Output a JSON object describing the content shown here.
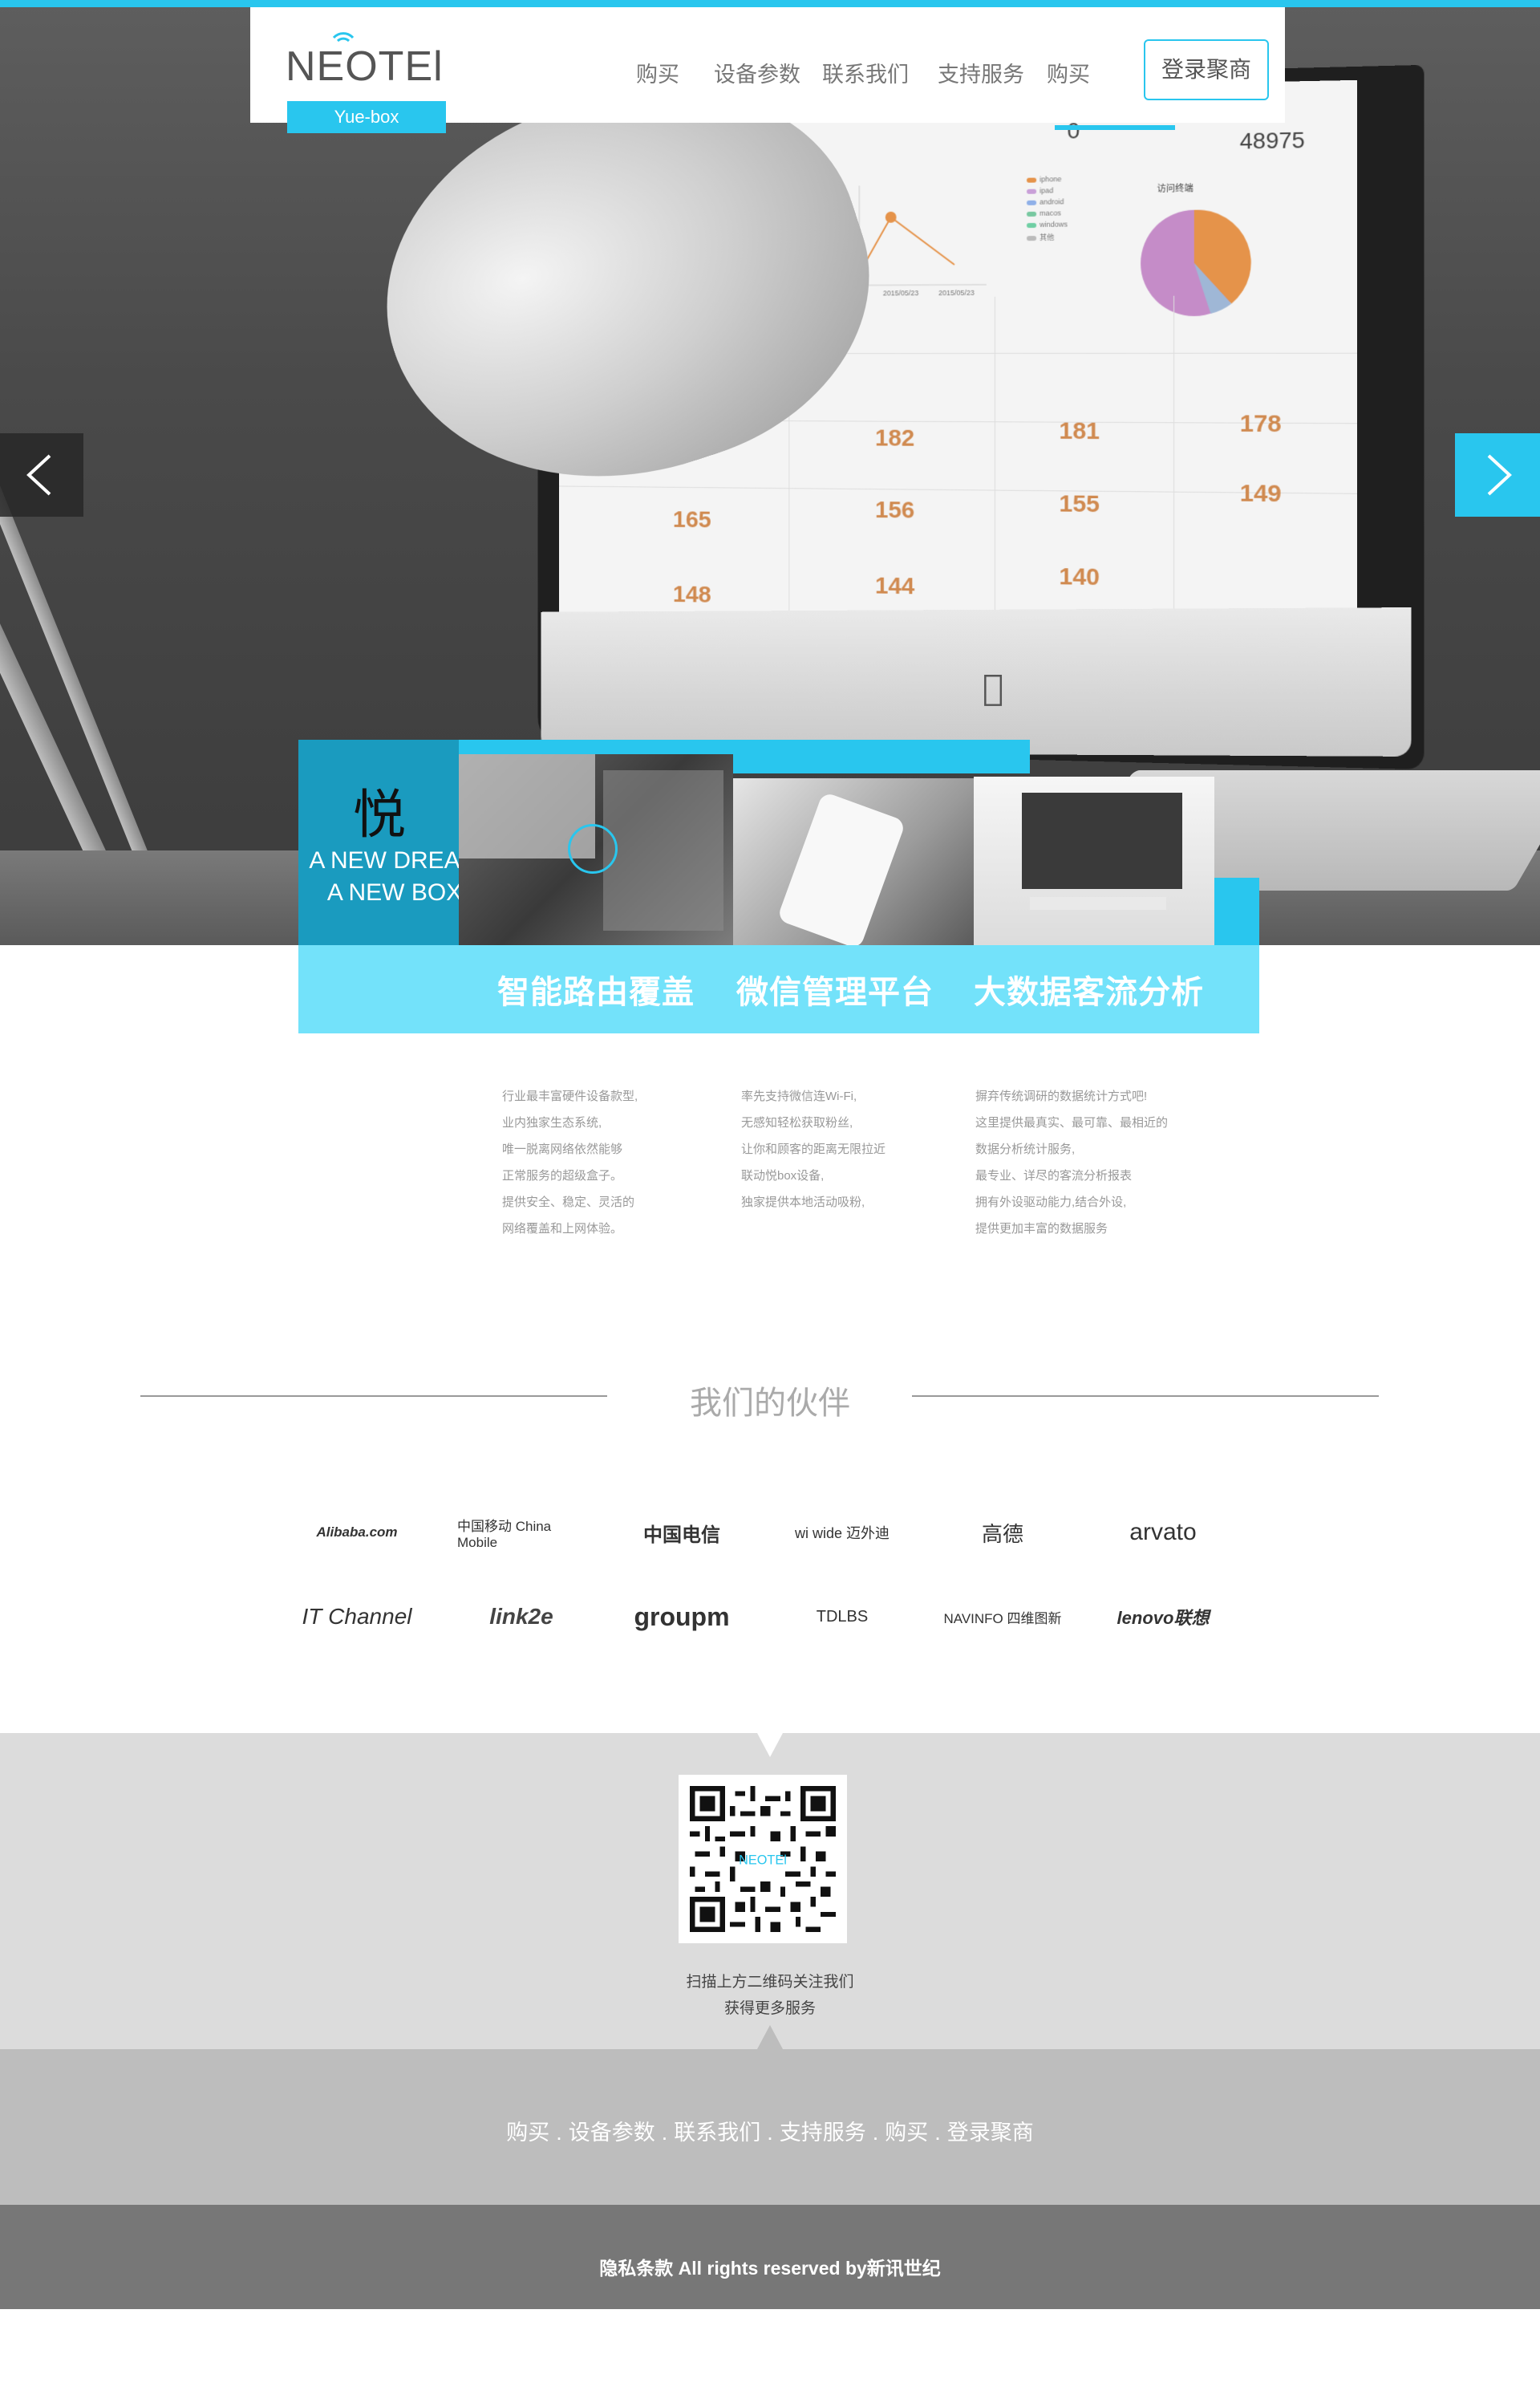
{
  "brand": {
    "logo": "NEOTEl",
    "sub": "Yue-box",
    "char": "悦",
    "slogan_line1": "A NEW DREAM",
    "slogan_line2": "A NEW BOX"
  },
  "nav": {
    "items": [
      "购买",
      "设备参数",
      "联系我们",
      "支持服务",
      "购买"
    ],
    "active_index": 2,
    "login_label": "登录聚商"
  },
  "hero_screen": {
    "top_value": "0",
    "visits_value": "48975",
    "visits_caption": "访问终端",
    "date_labels": [
      "2015/05/23",
      "2015/05/23"
    ],
    "legend": [
      "iphone",
      "ipad",
      "android",
      "macos",
      "windows",
      "其他"
    ],
    "cells": [
      "182",
      "181",
      "178",
      "165",
      "156",
      "155",
      "149",
      "148",
      "144",
      "140"
    ]
  },
  "colors": {
    "accent": "#29c6ee",
    "accent_light": "#73e2fa",
    "accent_dark": "#1a9bbf",
    "footer_nav_bg": "#bdbdbd",
    "copyright_bg": "#777777",
    "qr_bg": "#dcdcdc"
  },
  "features": {
    "labels": [
      "智能路由覆盖",
      "微信管理平台",
      "大数据客流分析"
    ],
    "columns": [
      [
        "行业最丰富硬件设备款型,",
        "业内独家生态系统,",
        "唯一脱离网络依然能够",
        "正常服务的超级盒子。",
        "提供安全、稳定、灵活的",
        "网络覆盖和上网体验。"
      ],
      [
        "率先支持微信连Wi-Fi,",
        "无感知轻松获取粉丝,",
        "让你和顾客的距离无限拉近",
        "联动悦box设备,",
        "独家提供本地活动吸粉,"
      ],
      [
        "摒弃传统调研的数据统计方式吧!",
        "这里提供最真实、最可靠、最相近的",
        "数据分析统计服务,",
        "最专业、详尽的客流分析报表",
        "拥有外设驱动能力,结合外设,",
        "提供更加丰富的数据服务"
      ]
    ]
  },
  "partners": {
    "title": "我们的伙伴",
    "logos": [
      {
        "name": "Alibaba.com",
        "icon": "alibaba-logo"
      },
      {
        "name": "中国移动 China Mobile",
        "icon": "china-mobile-logo"
      },
      {
        "name": "中国电信",
        "icon": "china-telecom-logo"
      },
      {
        "name": "wi wide 迈外迪",
        "icon": "wiwide-logo"
      },
      {
        "name": "高德",
        "icon": "autonavi-logo"
      },
      {
        "name": "arvato",
        "icon": "arvato-logo"
      },
      {
        "name": "IT Channel",
        "icon": "itchannel-logo"
      },
      {
        "name": "link2e",
        "icon": "link2e-logo"
      },
      {
        "name": "groupm",
        "icon": "groupm-logo"
      },
      {
        "name": "TDLBS",
        "icon": "tdlbs-logo"
      },
      {
        "name": "NAVINFO 四维图新",
        "icon": "navinfo-logo"
      },
      {
        "name": "lenovo联想",
        "icon": "lenovo-logo"
      }
    ]
  },
  "qr": {
    "caption_line1": "扫描上方二维码关注我们",
    "caption_line2": "获得更多服务"
  },
  "footer": {
    "links": [
      "购买",
      "设备参数",
      "联系我们",
      "支持服务",
      "购买",
      "登录聚商"
    ],
    "copyright": "隐私条款 All rights reserved by新讯世纪"
  }
}
